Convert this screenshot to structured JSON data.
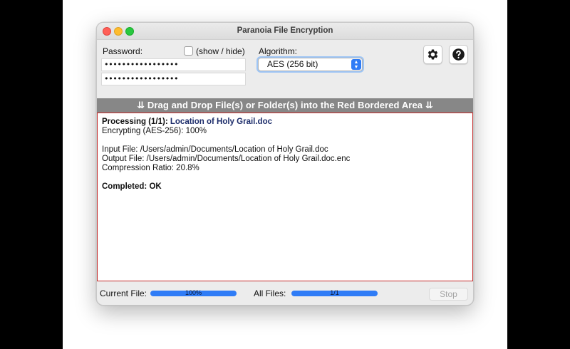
{
  "window": {
    "title": "Paranoia File Encryption"
  },
  "password": {
    "label": "Password:",
    "field1_value": "•••••••••••••••••",
    "field2_value": "•••••••••••••••••",
    "show_hide_label": "(show / hide)",
    "show_checked": false
  },
  "algorithm": {
    "label": "Algorithm:",
    "selected": "AES (256 bit)"
  },
  "toolbar": {
    "settings_icon": "gear-icon",
    "help_icon": "question-icon"
  },
  "banner": {
    "text": "⇊ Drag and Drop File(s) or Folder(s) into the Red Bordered Area ⇊"
  },
  "log": {
    "processing_label": "Processing (1/1): ",
    "processing_file": "Location of Holy Grail.doc",
    "encrypting": "Encrypting (AES-256): 100%",
    "input_file": "Input File: /Users/admin/Documents/Location of Holy Grail.doc",
    "output_file": "Output File: /Users/admin/Documents/Location of Holy Grail.doc.enc",
    "compression": "Compression Ratio: 20.8%",
    "completed": "Completed: OK"
  },
  "status": {
    "current_file_label": "Current File:",
    "current_file_progress_text": "100%",
    "current_file_progress": 1.0,
    "all_files_label": "All Files:",
    "all_files_progress_text": "1/1",
    "all_files_progress": 1.0,
    "stop_label": "Stop"
  },
  "colors": {
    "accent": "#2f7cf6",
    "drop_border": "#c42a2a",
    "banner_bg": "#878787",
    "filename": "#1d2d6b"
  }
}
